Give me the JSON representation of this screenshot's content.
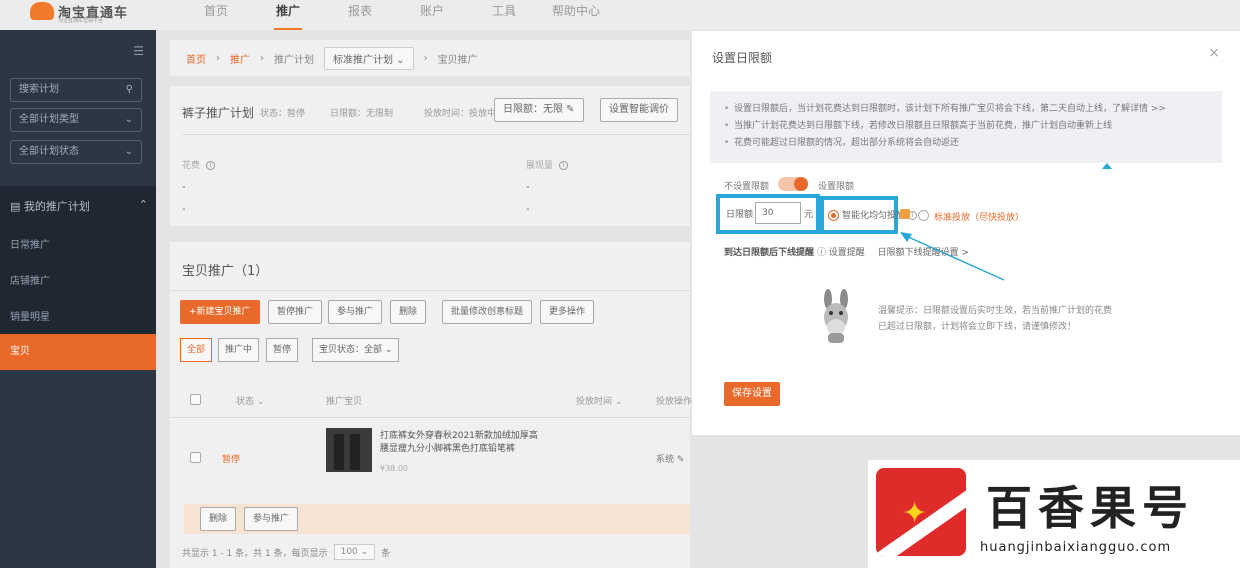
{
  "app": {
    "title": "淘宝直通车",
    "subtitle": "淘宝直通车营销平台"
  },
  "topnav": [
    "首页",
    "推广",
    "报表",
    "账户",
    "工具",
    "帮助中心"
  ],
  "sidebar": {
    "search_placeholder": "搜索计划",
    "filter_type": "全部计划类型",
    "filter_status": "全部计划状态",
    "group_title": "我的推广计划",
    "items": [
      "日常推广",
      "店铺推广",
      "销量明星",
      "宝贝"
    ]
  },
  "breadcrumb": {
    "home": "首页",
    "promo": "推广",
    "plan": "推广计划",
    "select": "标准推广计划",
    "current": "宝贝推广"
  },
  "plan": {
    "name": "裤子推广计划",
    "status_meta": "状态：暂停",
    "budget_meta": "日限额：无限制",
    "schedule_meta": "投放时间：投放中",
    "btn_budget": "日限额：无限 ✎",
    "btn_smart": "设置智能调价",
    "stat1_label": "花费",
    "stat2_label": "展现量",
    "stat_dash": "-"
  },
  "list": {
    "title": "宝贝推广（1）",
    "btn_new": "+新建宝贝推广",
    "btn_pause": "暂停推广",
    "btn_resume": "参与推广",
    "btn_delete": "删除",
    "btn_edit_creative": "批量修改创意标题",
    "btn_more": "更多操作",
    "seg_all": "全部",
    "seg_running": "推广中",
    "seg_paused": "暂停",
    "filter": "宝贝状态：全部",
    "th_status": "状态",
    "th_name": "推广宝贝",
    "th_time": "投放时间",
    "th_budget": "投放操作",
    "row_status": "暂停",
    "row_title": "打底裤女外穿春秋2021新款加绒加厚高腰显瘦九分小脚裤黑色打底铅笔裤",
    "row_sub": "¥38.00",
    "row_val": "系统 ✎",
    "foot_delete": "删除",
    "foot_resume": "参与推广",
    "pager_text": "共显示 1 - 1 条，共 1 条，每页显示",
    "pager_sel": "100",
    "pager_unit": "条"
  },
  "modal": {
    "title": "设置日限额",
    "close": "×",
    "notices": [
      "设置日限额后，当计划花费达到日限额时，该计划下所有推广宝贝将会下线，第二天自动上线，了解详情 >>",
      "当推广计划花费达到日限额下线，若修改日限额且日限额高于当前花费，推广计划自动重新上线",
      "花费可能超过日限额的情况，超出部分系统将会自动返还"
    ],
    "notice_link": "了解详情 >>",
    "toggle_left": "不设置限额",
    "toggle_right": "设置限额",
    "amount_label": "日限额",
    "amount_value": "30",
    "amount_unit": "元",
    "radio_smooth": "智能化均匀投放",
    "radio_standard": "标准投放（尽快投放）",
    "sub_line_bold": "到达日限额后下线提醒",
    "sub_line_a": "设置提醒",
    "sub_line_b": "日限额下线提醒设置 >",
    "tip": "温馨提示：日限额设置后实时生效，若当前推广计划的花费已超过日限额，计划将会立即下线，请谨慎修改！",
    "save": "保存设置"
  },
  "watermark": {
    "text": "百香果号",
    "url": "huangjinbaixiangguo.com"
  },
  "colors": {
    "accent": "#e8692a",
    "highlight": "#29a7d8",
    "sidebar": "#2c3645"
  }
}
